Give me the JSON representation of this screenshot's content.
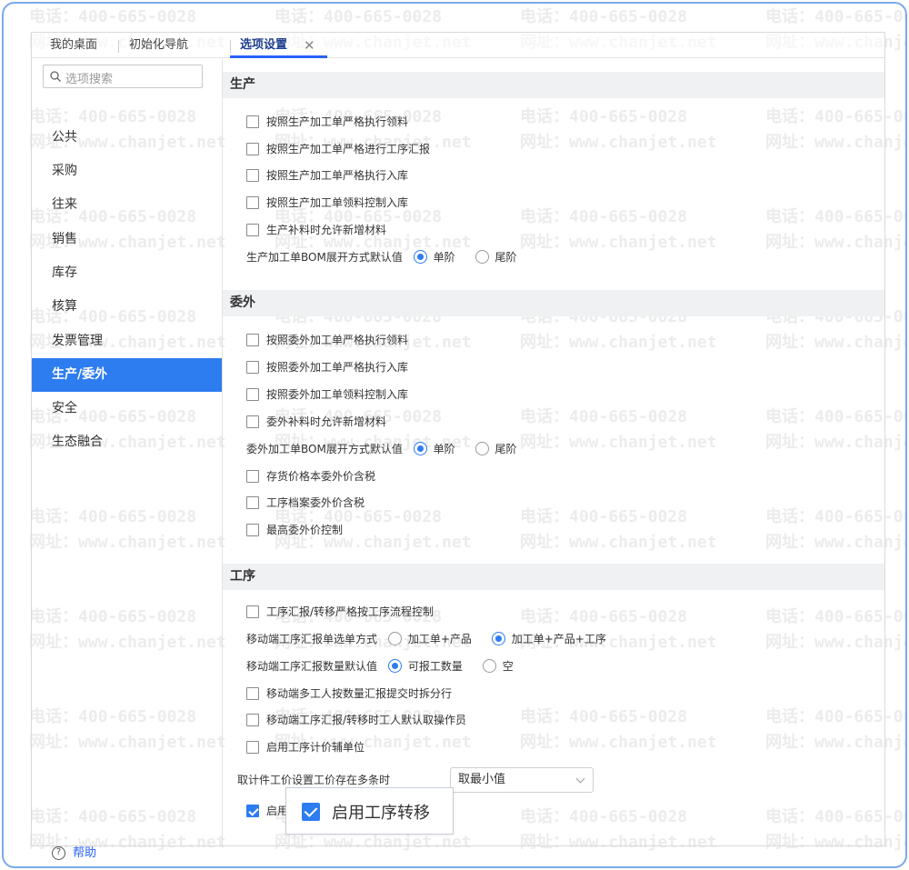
{
  "watermark": {
    "phone": "电话：400-665-0028",
    "site": "网址：www.chanjet.net"
  },
  "tabs": [
    {
      "label": "我的桌面"
    },
    {
      "label": "初始化导航"
    },
    {
      "label": "选项设置",
      "active": true
    }
  ],
  "tab_close_symbol": "✕",
  "search": {
    "placeholder": "选项搜索"
  },
  "sidebar": {
    "items": [
      {
        "label": "公共"
      },
      {
        "label": "采购"
      },
      {
        "label": "往来"
      },
      {
        "label": "销售"
      },
      {
        "label": "库存"
      },
      {
        "label": "核算"
      },
      {
        "label": "发票管理"
      },
      {
        "label": "生产/委外",
        "active": true
      },
      {
        "label": "安全"
      },
      {
        "label": "生态融合"
      }
    ],
    "help_label": "帮助"
  },
  "sections": {
    "production": {
      "title": "生产",
      "options": [
        "按照生产加工单严格执行领料",
        "按照生产加工单严格进行工序汇报",
        "按照生产加工单严格执行入库",
        "按照生产加工单领料控制入库",
        "生产补料时允许新增材料"
      ],
      "bom_label": "生产加工单BOM展开方式默认值",
      "bom_options": [
        "单阶",
        "尾阶"
      ],
      "bom_selected": "单阶"
    },
    "outsource": {
      "title": "委外",
      "options": [
        "按照委外加工单严格执行领料",
        "按照委外加工单严格执行入库",
        "按照委外加工单领料控制入库",
        "委外补料时允许新增材料"
      ],
      "bom_label": "委外加工单BOM展开方式默认值",
      "bom_options": [
        "单阶",
        "尾阶"
      ],
      "bom_selected": "单阶",
      "options2": [
        "存货价格本委外价含税",
        "工序档案委外价含税",
        "最高委外价控制"
      ]
    },
    "process": {
      "title": "工序",
      "option_flow": "工序汇报/转移严格按工序流程控制",
      "mobile_select_label": "移动端工序汇报单选单方式",
      "mobile_select_options": [
        "加工单+产品",
        "加工单+产品+工序"
      ],
      "mobile_select_selected": "加工单+产品+工序",
      "mobile_qty_label": "移动端工序汇报数量默认值",
      "mobile_qty_options": [
        "可报工数量",
        "空"
      ],
      "mobile_qty_selected": "可报工数量",
      "options": [
        "移动端多工人按数量汇报提交时拆分行",
        "移动端工序汇报/转移时工人默认取操作员",
        "启用工序计价辅单位"
      ],
      "price_label": "取计件工价设置工价存在多条时",
      "price_value": "取最小值",
      "transfer_partial": "启用",
      "transfer_checked": true
    }
  },
  "zoom_callout": {
    "label": "启用工序转移",
    "checked": true
  },
  "colors": {
    "accent": "#2d7cf0",
    "frame_border": "#7aa9e8",
    "active_tab": "#1e3f8f"
  }
}
